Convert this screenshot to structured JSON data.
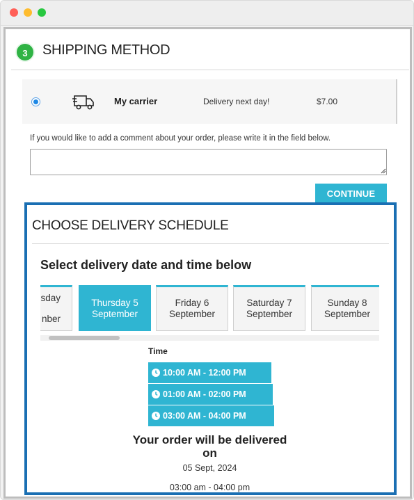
{
  "section": {
    "step_number": "3",
    "title": "SHIPPING METHOD"
  },
  "carrier": {
    "name": "My carrier",
    "delay": "Delivery next day!",
    "price": "$7.00",
    "selected": true
  },
  "comment": {
    "label": "If you would like to add a comment about your order, please write it in the field below.",
    "value": ""
  },
  "continue_button": "CONTINUE",
  "schedule": {
    "title": "CHOOSE DELIVERY SCHEDULE",
    "heading": "Select delivery date and time below",
    "dates": [
      {
        "line1": "sday",
        "line2": "nber",
        "selected": false,
        "partial": true
      },
      {
        "line1": "Thursday 5",
        "line2": "September",
        "selected": true,
        "partial": false
      },
      {
        "line1": "Friday 6",
        "line2": "September",
        "selected": false,
        "partial": false
      },
      {
        "line1": "Saturday 7",
        "line2": "September",
        "selected": false,
        "partial": false
      },
      {
        "line1": "Sunday 8",
        "line2": "September",
        "selected": false,
        "partial": false
      }
    ],
    "time_label": "Time",
    "time_slots": [
      "10:00 AM - 12:00 PM",
      "01:00 AM - 02:00 PM",
      "03:00 AM - 04:00 PM"
    ],
    "delivered_heading": "Your order will be delivered on",
    "delivered_date": "05 Sept, 2024",
    "delivered_time": "03:00 am - 04:00 pm"
  },
  "colors": {
    "accent": "#2fb5d2",
    "highlight_border": "#1a6fb3",
    "step_badge": "#2fb344"
  },
  "icons": {
    "carrier": "truck-icon",
    "time_slot": "clock-icon"
  }
}
